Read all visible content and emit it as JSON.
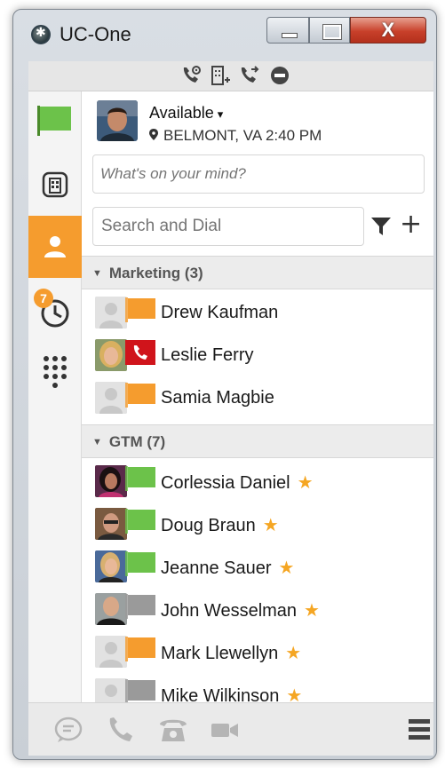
{
  "window": {
    "title": "UC-One",
    "close_glyph": "X"
  },
  "actionbar": {
    "icons": [
      "call-settings-icon",
      "directory-add-icon",
      "call-forward-icon",
      "do-not-disturb-icon"
    ]
  },
  "nav": {
    "items": [
      "status-flag-icon",
      "building-icon",
      "contacts-icon",
      "history-icon",
      "dialpad-icon"
    ],
    "history_badge": "7",
    "accent": "#f59c2e"
  },
  "profile": {
    "presence": "Available",
    "presence_caret": "▾",
    "location": "BELMONT, VA 2:40 PM"
  },
  "status_input": {
    "placeholder": "What's on your mind?"
  },
  "search": {
    "placeholder": "Search and Dial"
  },
  "groups": [
    {
      "title": "Marketing (3)",
      "contacts": [
        {
          "name": "Drew Kaufman",
          "flag": "orange",
          "photo": "placeholder",
          "favorite": false
        },
        {
          "name": "Leslie Ferry",
          "flag": "red-phone",
          "photo": "woman-blonde",
          "favorite": false
        },
        {
          "name": "Samia Magbie",
          "flag": "orange",
          "photo": "placeholder",
          "favorite": false
        }
      ]
    },
    {
      "title": "GTM (7)",
      "contacts": [
        {
          "name": "Corlessia Daniel",
          "flag": "green",
          "photo": "woman-dark",
          "favorite": true
        },
        {
          "name": "Doug Braun",
          "flag": "green",
          "photo": "man-glasses",
          "favorite": true
        },
        {
          "name": "Jeanne Sauer",
          "flag": "green",
          "photo": "woman-blonde-2",
          "favorite": true
        },
        {
          "name": "John Wesselman",
          "flag": "gray",
          "photo": "man-bald",
          "favorite": true
        },
        {
          "name": "Mark Llewellyn",
          "flag": "orange",
          "photo": "placeholder",
          "favorite": true
        },
        {
          "name": "Mike Wilkinson",
          "flag": "gray",
          "photo": "placeholder",
          "favorite": true
        }
      ]
    }
  ],
  "favorite_glyph": "★",
  "colors": {
    "green": "#6cc24a",
    "orange": "#f59c2e",
    "gray": "#9a9a9a",
    "red": "#d0141b",
    "star": "#f5a623"
  },
  "bottombar": {
    "icons": [
      "chat-icon",
      "phone-icon",
      "desk-phone-icon",
      "video-icon",
      "menu-icon"
    ]
  }
}
